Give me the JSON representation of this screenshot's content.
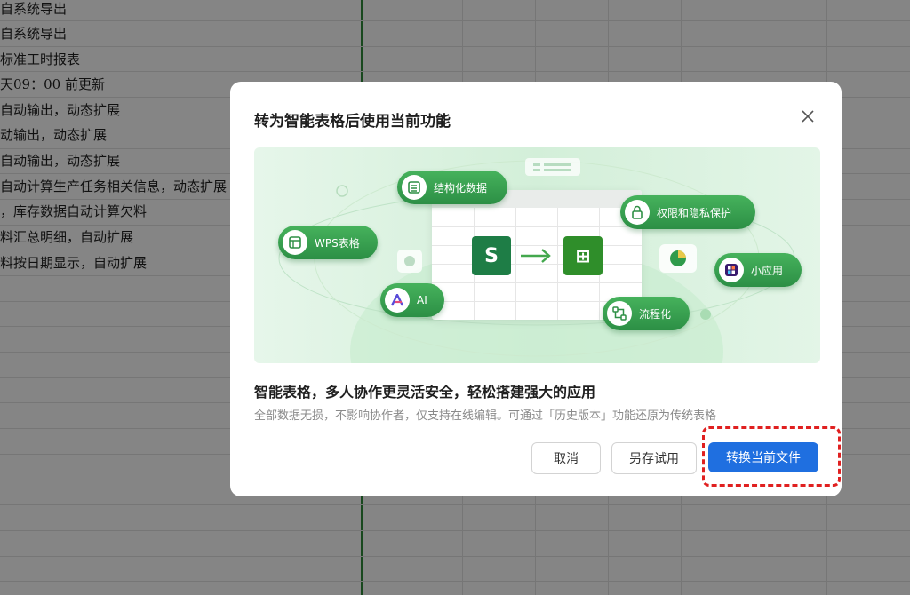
{
  "sheet": {
    "rows": [
      "自系统导出",
      "自系统导出",
      "标准工时报表",
      "天09：00 前更新",
      "自动输出，动态扩展",
      "动输出，动态扩展",
      "自动输出，动态扩展",
      "自动计算生产任务相关信息，动态扩展",
      "，库存数据自动计算欠料",
      "料汇总明细，自动扩展",
      "料按日期显示，自动扩展"
    ]
  },
  "dialog": {
    "title": "转为智能表格后使用当前功能",
    "close_icon": "close-icon",
    "banner": {
      "chips": {
        "structured": "结构化数据",
        "wps": "WPS表格",
        "ai": "AI",
        "permission": "权限和隐私保护",
        "miniapp": "小应用",
        "process": "流程化"
      },
      "icons": {
        "source_tile": "S",
        "target_tile": "⊞"
      }
    },
    "headline": "智能表格，多人协作更灵活安全，轻松搭建强大的应用",
    "description": "全部数据无损，不影响协作者，仅支持在线编辑。可通过「历史版本」功能还原为传统表格",
    "buttons": {
      "cancel": "取消",
      "save_as_try": "另存试用",
      "convert": "转换当前文件"
    },
    "colors": {
      "primary": "#1f6fe0",
      "chip_green": "#2c8f45",
      "highlight_red": "#e02020"
    }
  }
}
